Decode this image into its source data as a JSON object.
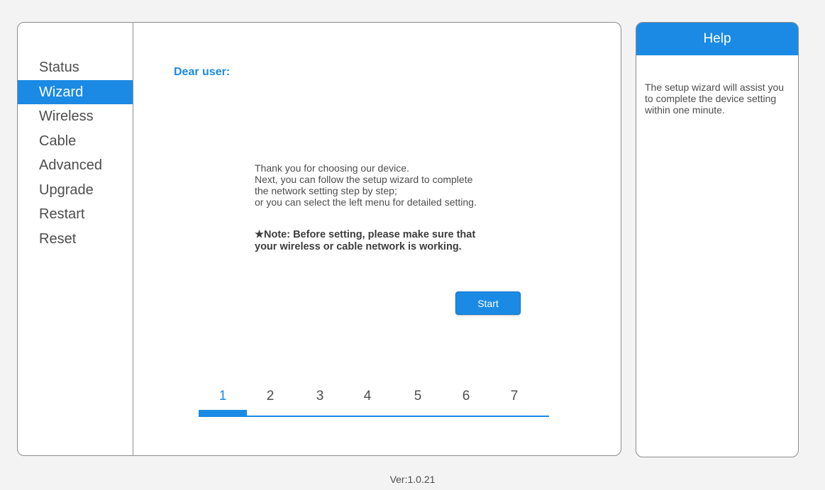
{
  "sidebar": {
    "items": [
      {
        "label": "Status"
      },
      {
        "label": "Wizard",
        "active": true
      },
      {
        "label": "Wireless"
      },
      {
        "label": "Cable"
      },
      {
        "label": "Advanced"
      },
      {
        "label": "Upgrade"
      },
      {
        "label": "Restart"
      },
      {
        "label": "Reset"
      }
    ]
  },
  "main": {
    "greeting": "Dear user:",
    "intro_lines": [
      "Thank you for choosing our device.",
      "Next, you can follow the setup wizard to complete",
      "the network setting step by step;",
      "or you can select the left menu for detailed setting."
    ],
    "note_lines": [
      "★Note: Before setting, please make sure that",
      "your wireless or cable network is working."
    ],
    "start_label": "Start",
    "steps": [
      "1",
      "2",
      "3",
      "4",
      "5",
      "6",
      "7"
    ],
    "current_step": 1
  },
  "help": {
    "title": "Help",
    "text": "The setup wizard will assist you to complete the device setting within one minute."
  },
  "footer": {
    "version": "Ver:1.0.21"
  },
  "colors": {
    "accent": "#1a8ae5",
    "text": "#4d4d4d",
    "background": "#f3f3f4"
  }
}
